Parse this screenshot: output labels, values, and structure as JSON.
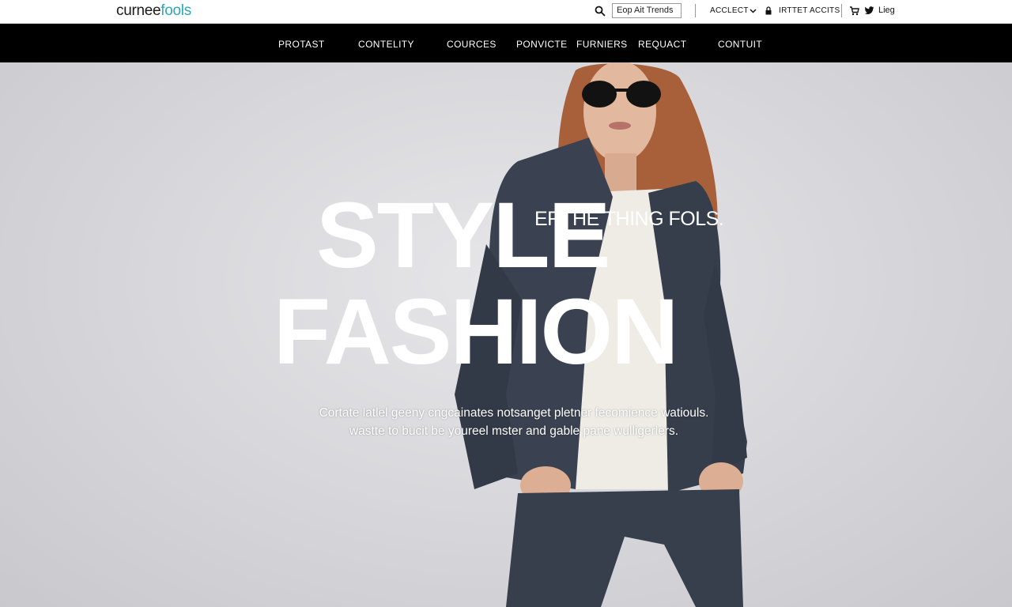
{
  "header": {
    "logo": {
      "part1": "curnee",
      "part2": "fools"
    },
    "search": {
      "value": "Eop Ait Trends"
    },
    "account": {
      "label": "ACCLECT"
    },
    "wishlist": {
      "label": "IRTTET ACCITS"
    },
    "lang": {
      "label": "Lieg"
    }
  },
  "nav": {
    "items": [
      {
        "label": "PROTAST"
      },
      {
        "label": "CONTELITY"
      },
      {
        "label": "COURCES"
      },
      {
        "label": "PONVICTE"
      },
      {
        "label": "FURNIERS"
      },
      {
        "label": "REQUACT"
      },
      {
        "label": "CONTUIT"
      }
    ]
  },
  "hero": {
    "headline_1": "STYLE",
    "headline_2": "FASHION",
    "tagline": "ERTHE THING FOLS.",
    "description_line_1": "Cortate latlel geeny cngcainates notsanget pletner fecomience watiouls.",
    "description_line_2": "wastte to bucit be youreel mster and gable pane wulligerlers."
  },
  "colors": {
    "accent": "#2fa7b5",
    "nav_bg": "#000000",
    "hero_bg": "#d9d9dd",
    "jacket": "#3a4150"
  },
  "icons": [
    "search-icon",
    "chevron-down-icon",
    "lock-icon",
    "cart-icon",
    "twitter-icon"
  ]
}
